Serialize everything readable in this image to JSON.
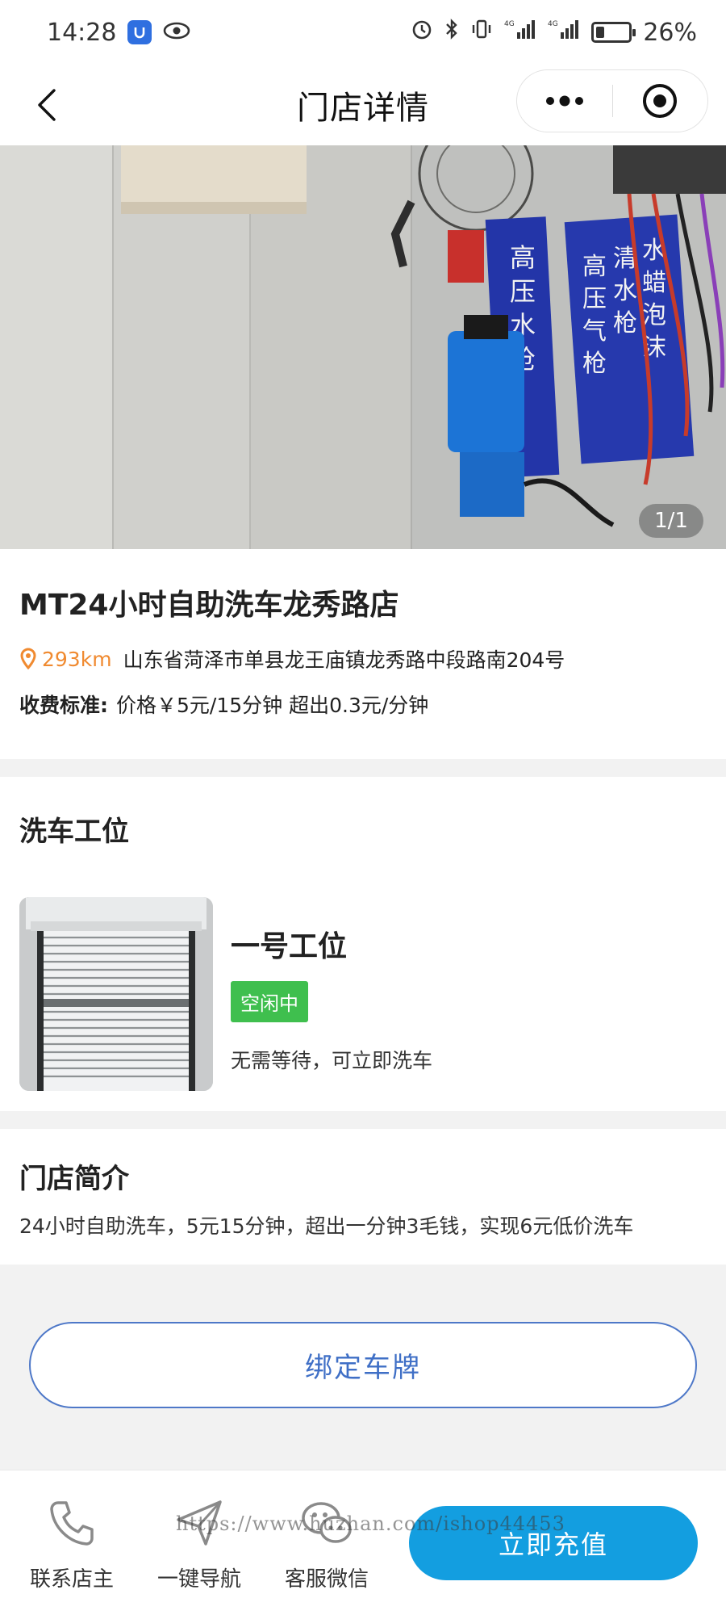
{
  "status_bar": {
    "time": "14:28",
    "battery": "26%",
    "battery_level": 0.26,
    "icons": [
      "app-icon",
      "eye-icon",
      "alarm-icon",
      "bluetooth-icon",
      "vibrate-icon",
      "signal-4g-icon",
      "signal-4g-icon",
      "battery-icon"
    ]
  },
  "nav": {
    "title": "门店详情",
    "back_icon": "chevron-left-icon",
    "more_icon": "more-dots-icon",
    "close_icon": "target-icon"
  },
  "banner": {
    "counter": "1/1",
    "sign_1": "高压水枪",
    "sign_2": "高压气枪",
    "sign_3": "清水枪",
    "sign_4": "水蜡泡沫"
  },
  "store": {
    "name": "MT24小时自助洗车龙秀路店",
    "distance": "293km",
    "address": "山东省菏泽市单县龙王庙镇龙秀路中段路南204号",
    "price_label": "收费标准:",
    "price_value": "价格￥5元/15分钟 超出0.3元/分钟"
  },
  "bays": {
    "title": "洗车工位",
    "items": [
      {
        "name": "一号工位",
        "status": "空闲中",
        "desc": "无需等待，可立即洗车"
      }
    ]
  },
  "intro": {
    "title": "门店简介",
    "text": "24小时自助洗车，5元15分钟，超出一分钟3毛钱，实现6元低价洗车"
  },
  "bind_button": "绑定车牌",
  "bottom_bar": {
    "contact": "联系店主",
    "navigate": "一键导航",
    "wechat": "客服微信",
    "recharge": "立即充值"
  },
  "watermark": "https://www.huzhan.com/ishop44453",
  "colors": {
    "accent_blue": "#139ee0",
    "bind_blue": "#3f6fc6",
    "status_green": "#3fbf4e",
    "distance_orange": "#f08a30"
  }
}
